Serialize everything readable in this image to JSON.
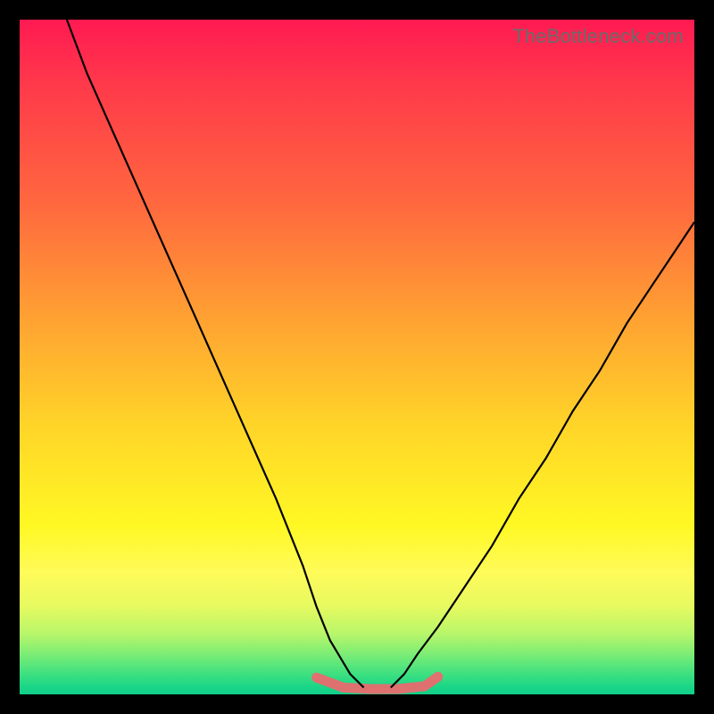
{
  "watermark": "TheBottleneck.com",
  "colors": {
    "frame": "#000000",
    "curve": "#000000",
    "floor_band": "#e96a6f"
  },
  "chart_data": {
    "type": "line",
    "title": "",
    "xlabel": "",
    "ylabel": "",
    "xlim": [
      0,
      100
    ],
    "ylim": [
      0,
      100
    ],
    "grid": false,
    "legend": false,
    "notes": "No axes, ticks, or numeric labels are rendered in the image. Data values are estimated from pixel positions on a 0–100 normalized coordinate system (origin at bottom-left of the gradient area). Two black curves form a V shape with minimum near x≈52; a short salmon-colored segment sits along y≈0 over roughly x∈[44,62] with small bumps.",
    "series": [
      {
        "name": "left-curve",
        "x": [
          7,
          10,
          14,
          18,
          22,
          26,
          30,
          34,
          38,
          42,
          44,
          46,
          49,
          51
        ],
        "values": [
          100,
          92,
          83,
          74,
          65,
          56,
          47,
          38,
          29,
          19,
          13,
          8,
          3,
          1
        ]
      },
      {
        "name": "right-curve",
        "x": [
          55,
          57,
          59,
          62,
          66,
          70,
          74,
          78,
          82,
          86,
          90,
          94,
          98,
          100
        ],
        "values": [
          1,
          3,
          6,
          10,
          16,
          22,
          29,
          35,
          42,
          48,
          55,
          61,
          67,
          70
        ]
      },
      {
        "name": "floor-band",
        "x": [
          44,
          48,
          52,
          56,
          60,
          62
        ],
        "values": [
          2.5,
          1.0,
          0.8,
          0.8,
          1.2,
          2.6
        ]
      }
    ]
  }
}
